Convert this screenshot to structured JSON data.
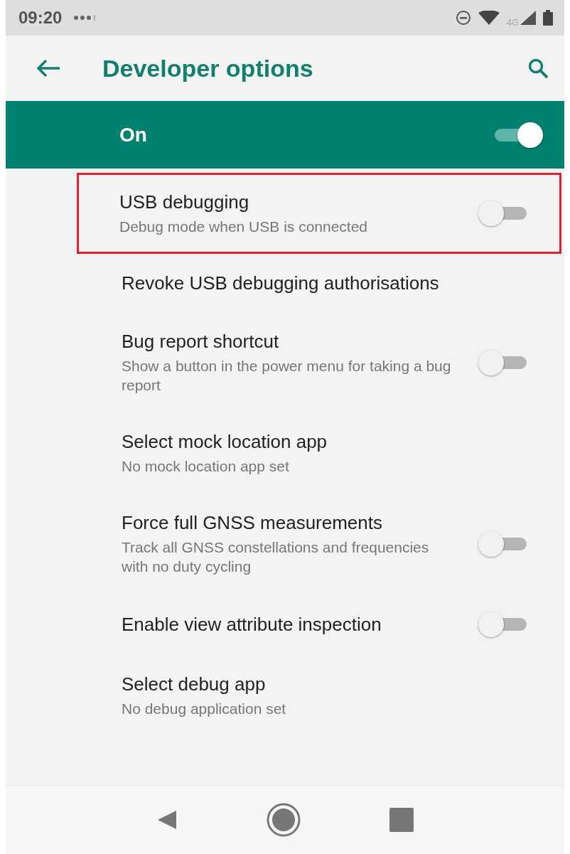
{
  "status_bar": {
    "time": "09:20",
    "network": "4G"
  },
  "app_bar": {
    "title": "Developer options"
  },
  "master_switch": {
    "label": "On",
    "on": true
  },
  "settings": [
    {
      "kind": "switch",
      "title": "USB debugging",
      "subtitle": "Debug mode when USB is connected",
      "on": false,
      "highlighted": true
    },
    {
      "kind": "plain",
      "title": "Revoke USB debugging authorisations",
      "highlighted": false
    },
    {
      "kind": "switch",
      "title": "Bug report shortcut",
      "subtitle": "Show a button in the power menu for taking a bug report",
      "on": false,
      "highlighted": false
    },
    {
      "kind": "plain",
      "title": "Select mock location app",
      "subtitle": "No mock location app set",
      "highlighted": false
    },
    {
      "kind": "switch",
      "title": "Force full GNSS measurements",
      "subtitle": "Track all GNSS constellations and frequencies with no duty cycling",
      "on": false,
      "highlighted": false
    },
    {
      "kind": "switch",
      "title": "Enable view attribute inspection",
      "on": false,
      "highlighted": false
    },
    {
      "kind": "plain",
      "title": "Select debug app",
      "subtitle": "No debug application set",
      "highlighted": false
    }
  ]
}
